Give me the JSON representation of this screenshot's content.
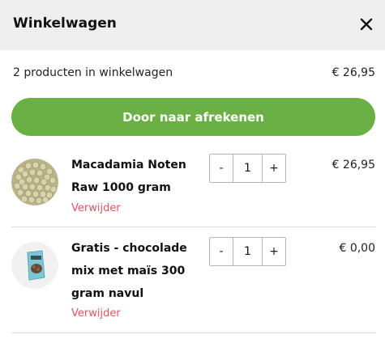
{
  "header": {
    "title": "Winkelwagen",
    "close_icon": "close-icon"
  },
  "summary": {
    "count_text": "2 producten in winkelwagen",
    "total": "€ 26,95"
  },
  "checkout": {
    "label": "Door naar afrekenen",
    "color": "#6bb044"
  },
  "items": [
    {
      "name": "Macadamia Noten Raw 1000 gram",
      "quantity": "1",
      "decrement": "-",
      "increment": "+",
      "price": "€ 26,95",
      "remove_label": "Verwijder"
    },
    {
      "name": "Gratis - chocolade mix met maïs 300 gram navul",
      "quantity": "1",
      "decrement": "-",
      "increment": "+",
      "price": "€ 0,00",
      "remove_label": "Verwijder"
    }
  ],
  "colors": {
    "accent": "#6bb044",
    "remove": "#e0555e",
    "header_bg": "#efefef"
  }
}
